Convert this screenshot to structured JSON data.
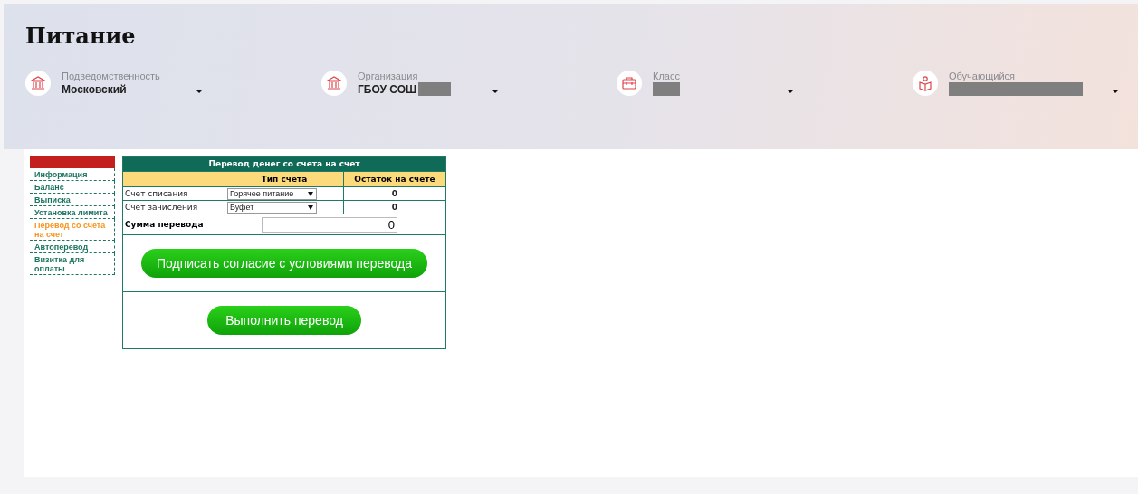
{
  "page_title": "Питание",
  "filters": [
    {
      "kind": "building",
      "label": "Подведомственность",
      "value": "Московский"
    },
    {
      "kind": "building",
      "label": "Организация",
      "value": "ГБОУ СОШ",
      "redacted": true
    },
    {
      "kind": "briefcase",
      "label": "Класс",
      "redacted": true
    },
    {
      "kind": "reader",
      "label": "Обучающийся",
      "redacted": true
    }
  ],
  "sidebar": {
    "items": [
      {
        "label": "Информация",
        "selected": false
      },
      {
        "label": "Баланс",
        "selected": false
      },
      {
        "label": "Выписка",
        "selected": false
      },
      {
        "label": "Установка лимита",
        "selected": false
      },
      {
        "label": "Перевод со счета на счет",
        "selected": true
      },
      {
        "label": "Автоперевод",
        "selected": false
      },
      {
        "label": "Визитка для оплаты",
        "selected": false
      }
    ]
  },
  "transfer": {
    "title": "Перевод денег со счета на счет",
    "columns": [
      "Тип счета",
      "Остаток на счете"
    ],
    "rows": [
      {
        "label": "Счет списания",
        "account": "Горячее питание",
        "balance": "0"
      },
      {
        "label": "Счет зачисления",
        "account": "Буфет",
        "balance": "0"
      }
    ],
    "amount_label": "Сумма перевода",
    "amount_value": "0",
    "consent_button": "Подписать согласие с условиями перевода",
    "execute_button": "Выполнить перевод"
  }
}
